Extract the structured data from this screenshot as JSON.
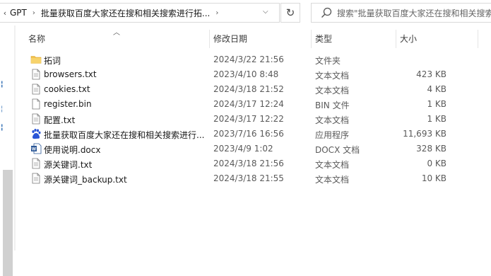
{
  "address_bar": {
    "breadcrumbs": [
      "GPT",
      "批量获取百度大家还在搜和相关搜索进行拓..."
    ],
    "refresh_glyph": "↻"
  },
  "search": {
    "placeholder": "搜索\"批量获取百度大家还在搜和相关搜索进"
  },
  "columns": {
    "name": "名称",
    "date": "修改日期",
    "type": "类型",
    "size": "大小"
  },
  "files": [
    {
      "name": "拓词",
      "date": "2024/3/22 21:56",
      "type": "文件夹",
      "size": "",
      "icon": "folder-icon"
    },
    {
      "name": "browsers.txt",
      "date": "2023/4/10 8:48",
      "type": "文本文档",
      "size": "423 KB",
      "icon": "text-file-icon"
    },
    {
      "name": "cookies.txt",
      "date": "2024/3/18 21:52",
      "type": "文本文档",
      "size": "4 KB",
      "icon": "text-file-icon"
    },
    {
      "name": "register.bin",
      "date": "2024/3/17 12:24",
      "type": "BIN 文件",
      "size": "1 KB",
      "icon": "bin-file-icon"
    },
    {
      "name": "配置.txt",
      "date": "2024/3/17 12:22",
      "type": "文本文档",
      "size": "1 KB",
      "icon": "text-file-icon"
    },
    {
      "name": "批量获取百度大家还在搜和相关搜索进行...",
      "date": "2023/7/16 16:56",
      "type": "应用程序",
      "size": "11,693 KB",
      "icon": "baidu-app-icon"
    },
    {
      "name": "使用说明.docx",
      "date": "2023/4/9 1:02",
      "type": "DOCX 文档",
      "size": "328 KB",
      "icon": "word-doc-icon"
    },
    {
      "name": "源关键词.txt",
      "date": "2024/3/18 21:56",
      "type": "文本文档",
      "size": "0 KB",
      "icon": "text-file-icon"
    },
    {
      "name": "源关键词_backup.txt",
      "date": "2024/3/18 21:55",
      "type": "文本文档",
      "size": "10 KB",
      "icon": "text-file-icon"
    }
  ],
  "colors": {
    "folder": "#f2c14e",
    "accent": "#2f6db3",
    "app_blue": "#2a55d6"
  }
}
